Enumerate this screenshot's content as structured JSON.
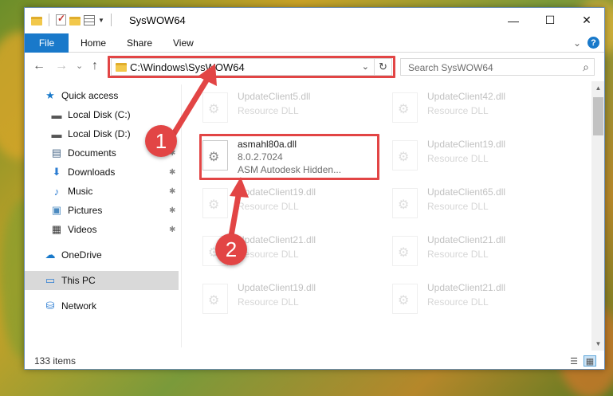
{
  "window": {
    "title": "SysWOW64",
    "minimize_glyph": "—",
    "maximize_glyph": "☐",
    "close_glyph": "✕"
  },
  "ribbon": {
    "tabs": [
      {
        "label": "File"
      },
      {
        "label": "Home"
      },
      {
        "label": "Share"
      },
      {
        "label": "View"
      }
    ],
    "expand_glyph": "⌄",
    "help_glyph": "?"
  },
  "navigation": {
    "back_glyph": "←",
    "forward_glyph": "→",
    "recent_glyph": "⌄",
    "up_glyph": "↑",
    "address": "C:\\Windows\\SysWOW64",
    "address_dropdown_glyph": "⌄",
    "refresh_glyph": "↻",
    "search_placeholder": "Search SysWOW64",
    "search_icon": "search-icon"
  },
  "sidebar": {
    "items": [
      {
        "label": "Quick access",
        "icon": "star-icon",
        "glyph": "★",
        "color": "#1979ca",
        "pinned": false
      },
      {
        "label": "Local Disk (C:)",
        "icon": "drive-icon",
        "glyph": "▬",
        "color": "#555555",
        "pinned": false
      },
      {
        "label": "Local Disk (D:)",
        "icon": "drive-icon",
        "glyph": "▬",
        "color": "#555555",
        "pinned": false
      },
      {
        "label": "Documents",
        "icon": "documents-icon",
        "glyph": "▤",
        "color": "#4b6a8a",
        "pinned": true
      },
      {
        "label": "Downloads",
        "icon": "download-icon",
        "glyph": "⬇",
        "color": "#2d7dd2",
        "pinned": true
      },
      {
        "label": "Music",
        "icon": "music-icon",
        "glyph": "♪",
        "color": "#2d7dd2",
        "pinned": true
      },
      {
        "label": "Pictures",
        "icon": "pictures-icon",
        "glyph": "▣",
        "color": "#4b8ac0",
        "pinned": true
      },
      {
        "label": "Videos",
        "icon": "videos-icon",
        "glyph": "▦",
        "color": "#333333",
        "pinned": true
      },
      {
        "label": "OneDrive",
        "icon": "cloud-icon",
        "glyph": "☁",
        "color": "#1979ca",
        "pinned": false
      },
      {
        "label": "This PC",
        "icon": "computer-icon",
        "glyph": "▭",
        "color": "#2d7dd2",
        "pinned": false
      },
      {
        "label": "Network",
        "icon": "network-icon",
        "glyph": "⛁",
        "color": "#2d7dd2",
        "pinned": false
      }
    ],
    "pin_glyph": "📌"
  },
  "files": [
    {
      "name": "UpdateClient5.dll",
      "type": "Resource DLL",
      "faded": true
    },
    {
      "name": "UpdateClient42.dll",
      "type": "Resource DLL",
      "faded": true
    },
    {
      "name": "asmahl80a.dll",
      "version": "8.0.2.7024",
      "description": "ASM Autodesk Hidden...",
      "faded": false
    },
    {
      "name": "UpdateClient19.dll",
      "type": "Resource DLL",
      "faded": true
    },
    {
      "name": "UpdateClient19.dll",
      "type": "Resource DLL",
      "faded": true
    },
    {
      "name": "UpdateClient65.dll",
      "type": "Resource DLL",
      "faded": true
    },
    {
      "name": "UpdateClient21.dll",
      "type": "Resource DLL",
      "faded": true
    },
    {
      "name": "UpdateClient21.dll",
      "type": "Resource DLL",
      "faded": true
    },
    {
      "name": "UpdateClient19.dll",
      "type": "Resource DLL",
      "faded": true
    },
    {
      "name": "UpdateClient21.dll",
      "type": "Resource DLL",
      "faded": true
    }
  ],
  "status": {
    "item_count": "133 items",
    "details_view_glyph": "☰",
    "tiles_view_glyph": "▦"
  },
  "callouts": [
    {
      "number": "1"
    },
    {
      "number": "2"
    }
  ],
  "colors": {
    "accent": "#1979ca",
    "highlight": "#e24545"
  }
}
